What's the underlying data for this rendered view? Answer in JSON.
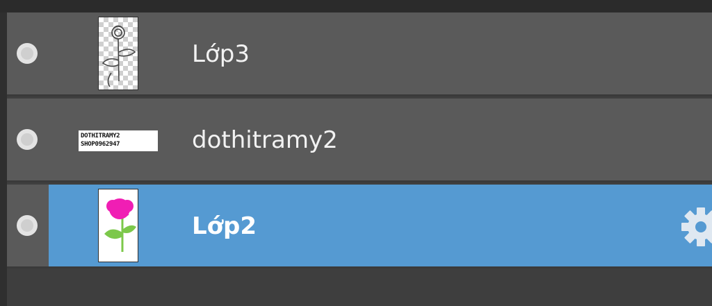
{
  "layers_panel": {
    "layers": [
      {
        "name": "Lớp3",
        "thumbnail": "rose-sketch-transparent",
        "visible": true,
        "selected": false
      },
      {
        "name": "dothitramy2",
        "thumbnail": "text-layer",
        "thumbnail_text": [
          "DOTHITRAMY2",
          "SHOP0962947"
        ],
        "visible": true,
        "selected": false
      },
      {
        "name": "Lớp2",
        "thumbnail": "pink-rose",
        "visible": true,
        "selected": true
      }
    ],
    "settings_icon": "gear-icon"
  },
  "colors": {
    "row_bg": "#5a5a5a",
    "selected_bg": "#559ad2",
    "panel_bg": "#3f3f3f",
    "rose_pink": "#f01eb4",
    "leaf_green": "#7cc84a"
  }
}
